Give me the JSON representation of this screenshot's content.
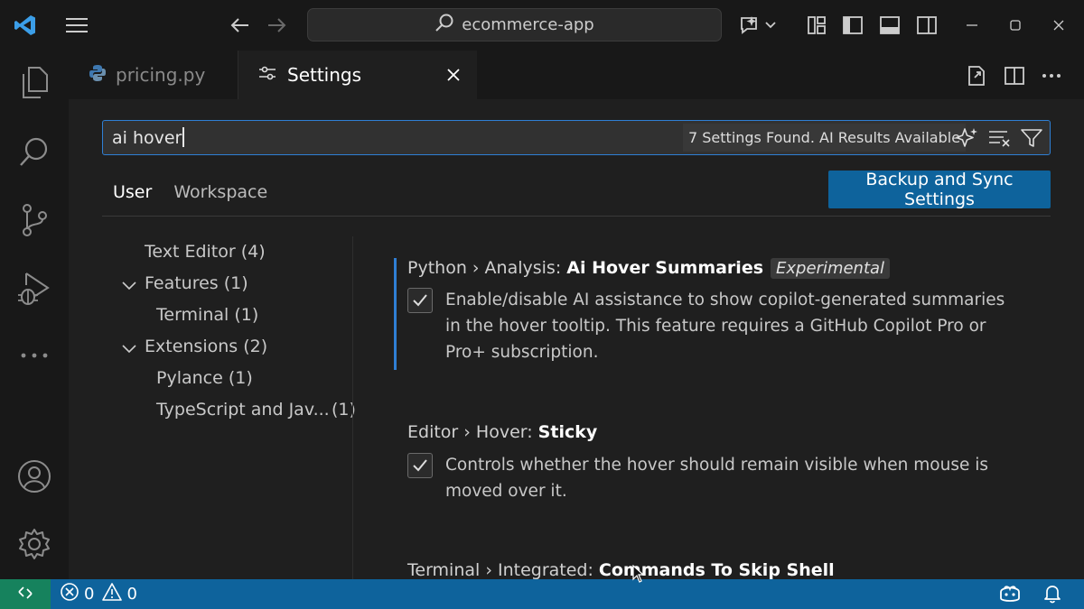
{
  "command_center": {
    "text": "ecommerce-app"
  },
  "tabs": [
    {
      "label": "pricing.py"
    },
    {
      "label": "Settings"
    }
  ],
  "search": {
    "value": "ai hover",
    "result_count": "7 Settings Found. AI Results Available"
  },
  "scopes": [
    {
      "label": "User"
    },
    {
      "label": "Workspace"
    }
  ],
  "sync_button": {
    "label": "Backup and Sync Settings"
  },
  "toc": [
    {
      "label": "Text Editor (4)"
    },
    {
      "label": "Features (1)"
    },
    {
      "label": "Terminal (1)"
    },
    {
      "label": "Extensions (2)"
    },
    {
      "label": "Pylance (1)"
    },
    {
      "label": "TypeScript and Jav...",
      "count": "(1)"
    }
  ],
  "settings": [
    {
      "prefix": "Python › Analysis: ",
      "name": "Ai Hover Summaries",
      "tag": "Experimental",
      "description": "Enable/disable AI assistance to show copilot-generated summaries in the hover tooltip. This feature requires a GitHub Copilot Pro or Pro+ subscription."
    },
    {
      "prefix": "Editor › Hover: ",
      "name": "Sticky",
      "description": "Controls whether the hover should remain visible when mouse is moved over it."
    },
    {
      "prefix": "Terminal › Integrated: ",
      "name": "Commands To Skip Shell"
    }
  ],
  "status": {
    "errors": "0",
    "warnings": "0"
  },
  "colors": {
    "accent": "#2f7fd4",
    "button": "#0e639c",
    "statusbar": "#0e639c",
    "remote": "#16825d",
    "vscode": "#3b9ee8"
  }
}
